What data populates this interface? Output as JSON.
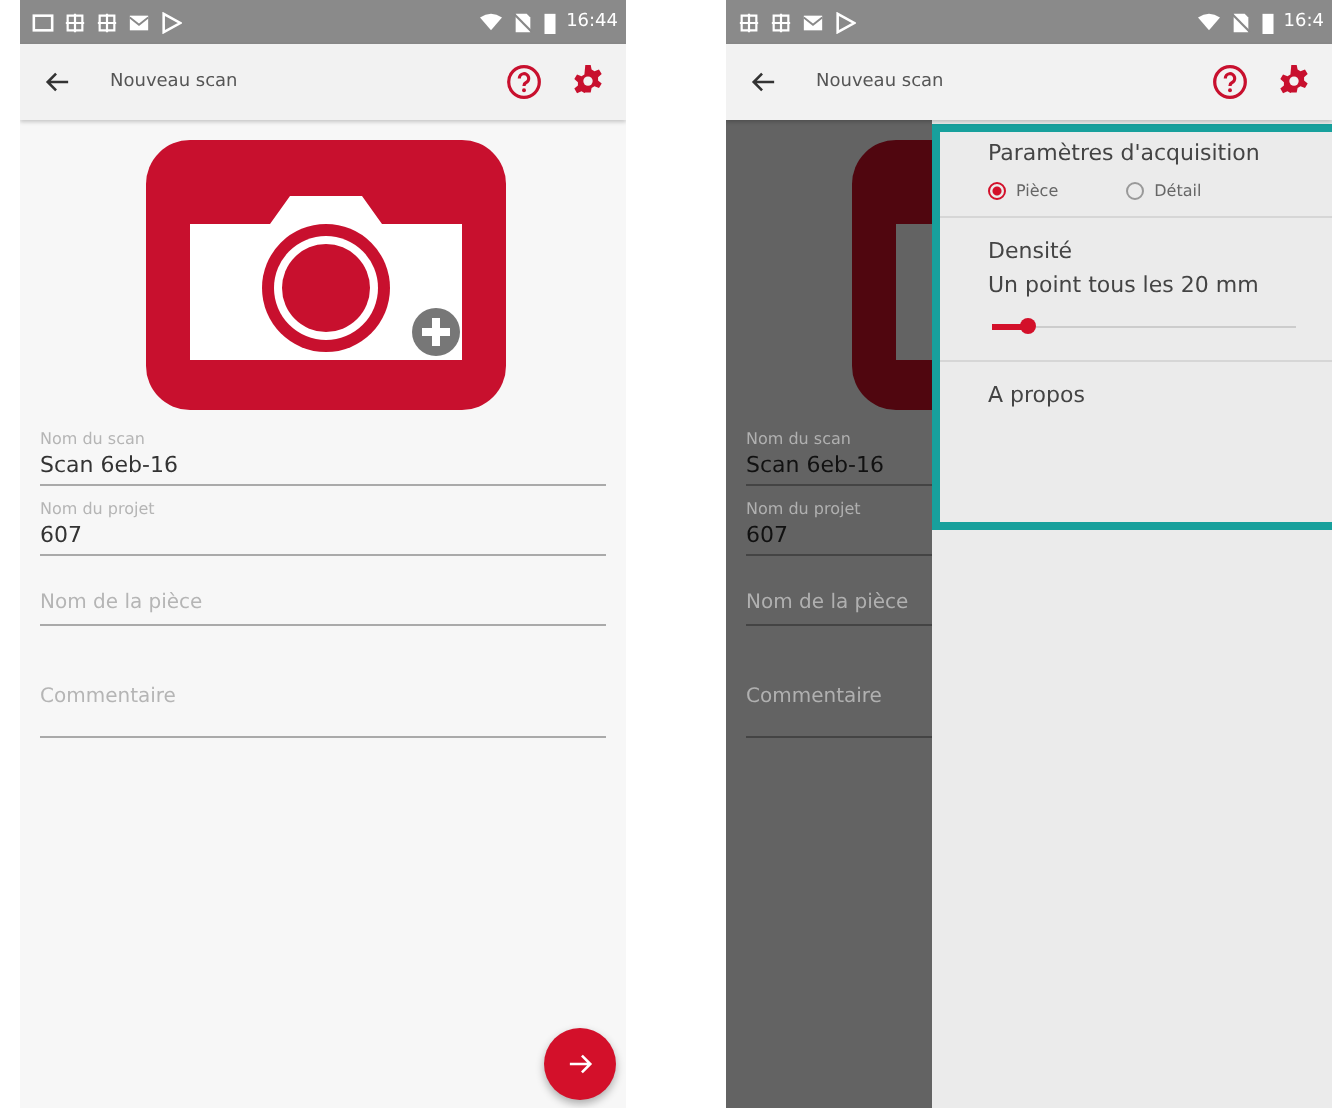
{
  "screens": [
    {
      "status_bar": {
        "notification_icons": [
          {
            "kind": "image"
          },
          {
            "kind": "grid"
          },
          {
            "kind": "grid"
          },
          {
            "kind": "mail"
          },
          {
            "kind": "play"
          }
        ],
        "time": "16:44"
      },
      "app_bar": {
        "title": "Nouveau scan"
      },
      "fields": [
        {
          "kind": "filled",
          "label": "Nom du scan",
          "value": "Scan 6eb-16"
        },
        {
          "kind": "filled",
          "label": "Nom du projet",
          "value": "607"
        },
        {
          "kind": "empty",
          "placeholder": "Nom de la pièce"
        },
        {
          "kind": "multiline",
          "placeholder": "Commentaire"
        }
      ],
      "dimmed": false,
      "fab": {
        "kind": "next"
      }
    },
    {
      "status_bar": {
        "notification_icons": [
          {
            "kind": "grid"
          },
          {
            "kind": "grid"
          },
          {
            "kind": "mail"
          },
          {
            "kind": "play"
          }
        ],
        "time": "16:4"
      },
      "app_bar": {
        "title": "Nouveau scan"
      },
      "fields": [
        {
          "kind": "filled",
          "label": "Nom du scan",
          "value": "Scan 6eb-16"
        },
        {
          "kind": "filled",
          "label": "Nom du projet",
          "value": "607"
        },
        {
          "kind": "empty",
          "placeholder": "Nom de la pièce"
        },
        {
          "kind": "multiline",
          "placeholder": "Commentaire"
        }
      ],
      "dimmed": true,
      "drawer": {
        "highlighted": true,
        "title": "Paramètres d'acquisition",
        "options": [
          {
            "label": "Pièce",
            "selected": true
          },
          {
            "label": "Détail",
            "selected": false
          }
        ],
        "density": {
          "title": "Densité",
          "reading": "Un point tous les 20 mm",
          "level": 0.12
        },
        "items": [
          "A propos"
        ]
      }
    }
  ]
}
